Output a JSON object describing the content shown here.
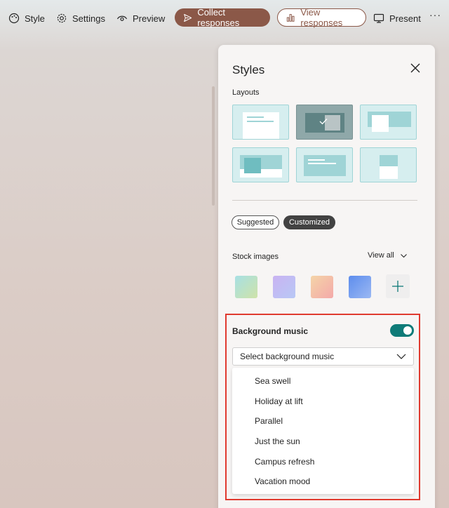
{
  "toolbar": {
    "style_label": "Style",
    "settings_label": "Settings",
    "preview_label": "Preview",
    "collect_label": "Collect responses",
    "view_label": "View responses",
    "present_label": "Present",
    "more_label": "···"
  },
  "panel": {
    "title": "Styles",
    "layouts_label": "Layouts",
    "chips": {
      "suggested": "Suggested",
      "customized": "Customized"
    },
    "stock_images_label": "Stock images",
    "view_all_label": "View all",
    "swatches": [
      {
        "name": "teal-gradient",
        "from": "#a7e0e4",
        "to": "#cfe3a8"
      },
      {
        "name": "lavender-gradient",
        "from": "#c9b3f2",
        "to": "#b8c8f5"
      },
      {
        "name": "peach-gradient",
        "from": "#f4c8b5",
        "to": "#f4a9a9"
      },
      {
        "name": "blue-gradient",
        "from": "#5d8ded",
        "to": "#9bb8f3"
      }
    ],
    "music": {
      "label": "Background music",
      "enabled": true,
      "select_placeholder": "Select background music",
      "options": [
        "Sea swell",
        "Holiday at lift",
        "Parallel",
        "Just the sun",
        "Campus refresh",
        "Vacation mood"
      ]
    }
  },
  "colors": {
    "accent": "#8b5848",
    "toggle_on": "#0f7b78",
    "highlight_border": "#e03a2f",
    "layout_fill": "#d6eeef"
  },
  "icons": [
    "palette-icon",
    "gear-icon",
    "eye-icon",
    "send-icon",
    "bar-chart-icon",
    "monitor-icon",
    "close-icon",
    "chevron-down-icon",
    "plus-icon"
  ]
}
